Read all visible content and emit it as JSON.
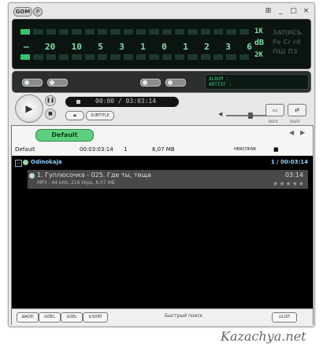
{
  "titlebar": {
    "logo_text": "GOM",
    "logo2_text": "P",
    "min": "_",
    "max": "□",
    "close": "×",
    "pin": "⊞"
  },
  "display": {
    "eq_labels": [
      "20",
      "10",
      "5",
      "3",
      "1",
      "0",
      "1",
      "2",
      "3",
      "6"
    ],
    "db_top": "1K",
    "db_mid": "dB",
    "db_bot": "2K",
    "rec_lines": [
      "ЗАПИСЬ",
      "Fe Cr rd",
      "ПШ П3"
    ]
  },
  "status": {
    "album_label": "ALBUM :",
    "artist_label": "ARTIST :"
  },
  "transport": {
    "time": "00:00 / 03:03:14",
    "subtitle_label": "SUBTITLE",
    "dock_label": "DOCK",
    "shuffle_label": "SHUFF"
  },
  "playlist": {
    "tab_label": "Default",
    "default_row": {
      "name": "Default",
      "time": "00:03:03:14",
      "count": "1",
      "size": "6,07 MB",
      "mode": "НЕИСПРАВ"
    },
    "group": {
      "label": "Odinokaja",
      "counter": "1 / 00:03:14"
    },
    "track": {
      "title": "1. Гуплюсочка - 025. Где ты, теща",
      "duration": "03:14",
      "info": "MP3 : 44 kHz, 216 kbps, 6,07 MB",
      "rating": "★★★★★"
    },
    "bottom_buttons": {
      "add": "ADD",
      "del": "DEL",
      "sel": "SEL",
      "sort": "SORT",
      "list": "LIST"
    },
    "search_label": "Быстрый поиск"
  },
  "watermark": "Kazachya.net"
}
